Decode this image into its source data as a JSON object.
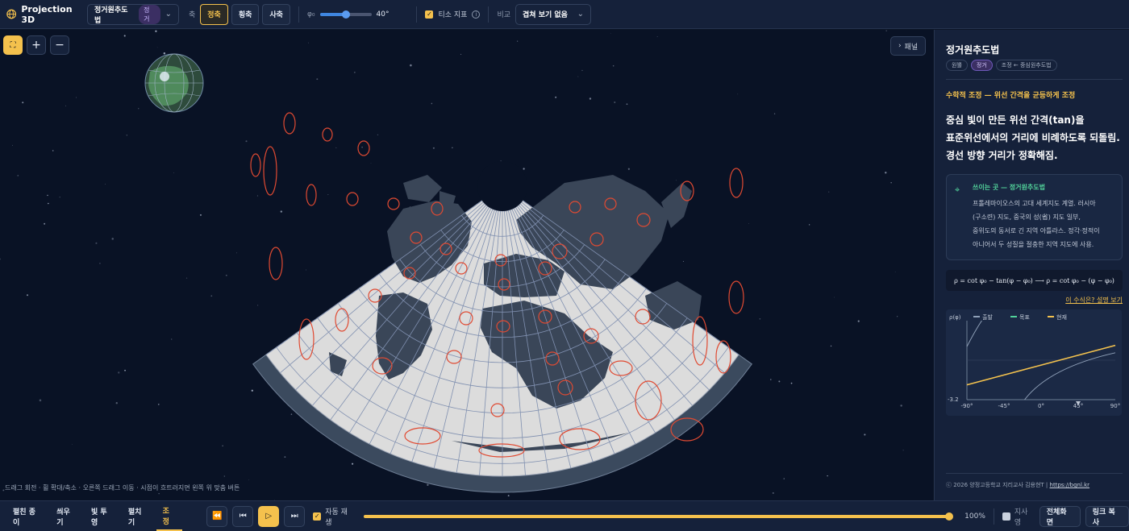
{
  "app": {
    "title": "Projection 3D"
  },
  "toolbar": {
    "projection": {
      "value": "정거원추도법",
      "badge": "정거"
    },
    "axis_label": "축",
    "axis_options": [
      "정축",
      "횡축",
      "사축"
    ],
    "axis_selected": "정축",
    "phi_label": "φ₀",
    "phi_value": "40°",
    "phi_fraction": 0.5,
    "tissot": {
      "label": "티소 지표",
      "checked": true
    },
    "compare_label": "비교",
    "compare_value": "겹쳐 보기 없음"
  },
  "map": {
    "panel_toggle": "패널",
    "hint": "드래그 회전 · 휠 확대/축소 · 오른쪽 드래그 이동 · 시점이 흐트러지면 왼쪽 위 맞춤 버튼"
  },
  "side": {
    "title": "정거원추도법",
    "chips": [
      "원뿔",
      "정거",
      "조정 ← 중심원추도법"
    ],
    "chip_active": 1,
    "section_heading": "수학적 조정 — 위선 간격을 균등하게 조정",
    "lead": [
      "중심 빛이 만든 위선 간격(tan)을",
      "표준위선에서의 거리에 비례하도록 되돌림.",
      "경선 방향 거리가 정확해짐."
    ],
    "usage": {
      "title": "쓰이는 곳 — 정거원추도법",
      "body": [
        "프톨레마이오스의 고대 세계지도 계열. 러시아",
        "(구소련) 지도, 중국의 성(省) 지도 일부,",
        "중위도의 동서로 긴 지역 아틀라스. 정각·정적이",
        "아니어서 두 성질을 절충한 지역 지도에 사용."
      ]
    },
    "formula": "ρ = cot φ₀ − tan(φ − φ₀)  ⟶  ρ = cot φ₀ − (φ − φ₀)",
    "formula_link": "이 수식은? 설명 보기",
    "credit": "ⓒ 2026 양정고등학교 지리교사 김용현T | ",
    "credit_link": "https://bgnl.kr"
  },
  "chart_data": {
    "type": "line",
    "ylabel": "ρ(φ)",
    "ylim_label": "-3.2",
    "xticks": [
      "-90°",
      "-45°",
      "0°",
      "45°",
      "90°"
    ],
    "legend": [
      {
        "name": "출발",
        "color": "#8fa0b8"
      },
      {
        "name": "목표",
        "color": "#52d39b"
      },
      {
        "name": "현재",
        "color": "#f4c14d"
      }
    ],
    "x": [
      -90,
      -45,
      0,
      45,
      90
    ],
    "series": [
      {
        "name": "출발",
        "values": [
          null,
          null,
          -0.8,
          0.9,
          2.6
        ]
      },
      {
        "name": "목표",
        "values": [
          -2.0,
          -1.2,
          -0.4,
          0.4,
          1.2
        ]
      },
      {
        "name": "현재",
        "values": [
          -2.0,
          -1.2,
          -0.4,
          0.4,
          1.2
        ]
      }
    ]
  },
  "bottom": {
    "stages": [
      "펼친 종이",
      "씌우기",
      "빛 투영",
      "펼치기",
      "조정"
    ],
    "stage_active": 4,
    "autoplay": {
      "label": "자동 재생",
      "checked": true
    },
    "progress_label": "100%",
    "progress": 1.0,
    "graticule": {
      "label": "지사영",
      "checked": false
    },
    "fullscreen": "전체화면",
    "copy_link": "링크 복사"
  }
}
